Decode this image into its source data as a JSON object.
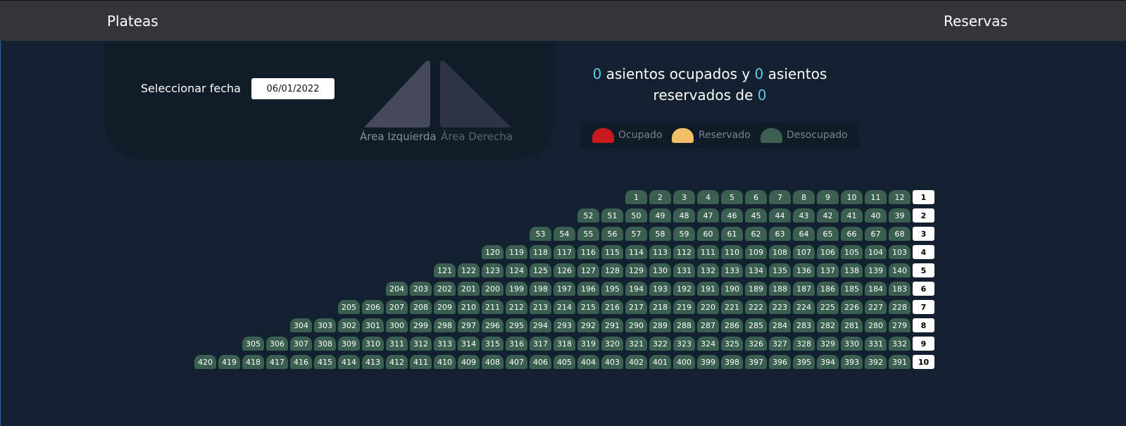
{
  "nav": {
    "brand": "Plateas",
    "reservas_link": "Reservas"
  },
  "date_picker": {
    "label": "Seleccionar fecha",
    "value": "06/01/2022"
  },
  "areas": {
    "left": "Área Izquierda",
    "right": "Área Derecha",
    "selected": "left"
  },
  "summary": {
    "occupied_count": "0",
    "text_1": " asientos ocupados y ",
    "reserved_count": "0",
    "text_2": " asientos reservados de ",
    "total_count": "0"
  },
  "legend": [
    {
      "label": "Ocupado",
      "color": "#c8191b"
    },
    {
      "label": "Reservado",
      "color": "#f0c069"
    },
    {
      "label": "Desocupado",
      "color": "#3b5f50"
    }
  ],
  "seat_color_free": "#3b5f50",
  "rows": [
    {
      "label": "1",
      "seats": [
        "1",
        "2",
        "3",
        "4",
        "5",
        "6",
        "7",
        "8",
        "9",
        "10",
        "11",
        "12"
      ]
    },
    {
      "label": "2",
      "seats": [
        "52",
        "51",
        "50",
        "49",
        "48",
        "47",
        "46",
        "45",
        "44",
        "43",
        "42",
        "41",
        "40",
        "39"
      ]
    },
    {
      "label": "3",
      "seats": [
        "53",
        "54",
        "55",
        "56",
        "57",
        "58",
        "59",
        "60",
        "61",
        "62",
        "63",
        "64",
        "65",
        "66",
        "67",
        "68"
      ]
    },
    {
      "label": "4",
      "seats": [
        "120",
        "119",
        "118",
        "117",
        "116",
        "115",
        "114",
        "113",
        "112",
        "111",
        "110",
        "109",
        "108",
        "107",
        "106",
        "105",
        "104",
        "103"
      ]
    },
    {
      "label": "5",
      "seats": [
        "121",
        "122",
        "123",
        "124",
        "125",
        "126",
        "127",
        "128",
        "129",
        "130",
        "131",
        "132",
        "133",
        "134",
        "135",
        "136",
        "137",
        "138",
        "139",
        "140"
      ]
    },
    {
      "label": "6",
      "seats": [
        "204",
        "203",
        "202",
        "201",
        "200",
        "199",
        "198",
        "197",
        "196",
        "195",
        "194",
        "193",
        "192",
        "191",
        "190",
        "189",
        "188",
        "187",
        "186",
        "185",
        "184",
        "183"
      ]
    },
    {
      "label": "7",
      "seats": [
        "205",
        "206",
        "207",
        "208",
        "209",
        "210",
        "211",
        "212",
        "213",
        "214",
        "215",
        "216",
        "217",
        "218",
        "219",
        "220",
        "221",
        "222",
        "223",
        "224",
        "225",
        "226",
        "227",
        "228"
      ]
    },
    {
      "label": "8",
      "seats": [
        "304",
        "303",
        "302",
        "301",
        "300",
        "299",
        "298",
        "297",
        "296",
        "295",
        "294",
        "293",
        "292",
        "291",
        "290",
        "289",
        "288",
        "287",
        "286",
        "285",
        "284",
        "283",
        "282",
        "281",
        "280",
        "279"
      ]
    },
    {
      "label": "9",
      "seats": [
        "305",
        "306",
        "307",
        "308",
        "309",
        "310",
        "311",
        "312",
        "313",
        "314",
        "315",
        "316",
        "317",
        "318",
        "319",
        "320",
        "321",
        "322",
        "323",
        "324",
        "325",
        "326",
        "327",
        "328",
        "329",
        "330",
        "331",
        "332"
      ]
    },
    {
      "label": "10",
      "seats": [
        "420",
        "419",
        "418",
        "417",
        "416",
        "415",
        "414",
        "413",
        "412",
        "411",
        "410",
        "409",
        "408",
        "407",
        "406",
        "405",
        "404",
        "403",
        "402",
        "401",
        "400",
        "399",
        "398",
        "397",
        "396",
        "395",
        "394",
        "393",
        "392",
        "391"
      ]
    }
  ]
}
